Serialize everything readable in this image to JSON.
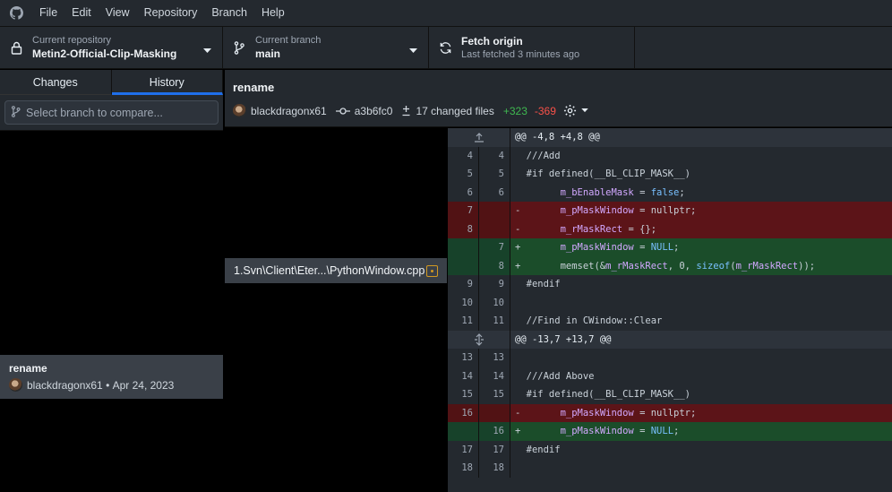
{
  "menu": [
    "File",
    "Edit",
    "View",
    "Repository",
    "Branch",
    "Help"
  ],
  "toolbar": {
    "repo_label": "Current repository",
    "repo_value": "Metin2-Official-Clip-Masking",
    "branch_label": "Current branch",
    "branch_value": "main",
    "fetch_label": "Fetch origin",
    "fetch_sub": "Last fetched 3 minutes ago"
  },
  "tabs": {
    "changes": "Changes",
    "history": "History"
  },
  "compare": {
    "placeholder": "Select branch to compare..."
  },
  "history": {
    "title": "rename",
    "author": "blackdragonx61",
    "date": "Apr 24, 2023"
  },
  "commit": {
    "title": "rename",
    "author": "blackdragonx61",
    "sha": "a3b6fc0",
    "changed": "17 changed files",
    "additions": "+323",
    "deletions": "-369"
  },
  "file": {
    "path": "1.Svn\\Client\\Eter...\\PythonWindow.cpp"
  },
  "diff": {
    "hunk1": "@@ -4,8 +4,8 @@",
    "hunk2": "@@ -13,7 +13,7 @@",
    "lines": [
      {
        "old": "4",
        "new": "4",
        "t": "ctx",
        "text": "///Add"
      },
      {
        "old": "5",
        "new": "5",
        "t": "ctx",
        "text": "#if defined(__BL_CLIP_MASK__)"
      },
      {
        "old": "6",
        "new": "6",
        "t": "ctx",
        "text": "m_bEnableMask = false;"
      },
      {
        "old": "7",
        "new": "",
        "t": "rem",
        "text": "m_pMaskWindow = nullptr;"
      },
      {
        "old": "8",
        "new": "",
        "t": "rem",
        "text": "m_rMaskRect = {};"
      },
      {
        "old": "",
        "new": "7",
        "t": "ins",
        "text": "m_pMaskWindow = NULL;"
      },
      {
        "old": "",
        "new": "8",
        "t": "ins",
        "text": "memset(&m_rMaskRect, 0, sizeof(m_rMaskRect));"
      },
      {
        "old": "9",
        "new": "9",
        "t": "ctx",
        "text": "#endif"
      },
      {
        "old": "10",
        "new": "10",
        "t": "ctx",
        "text": ""
      },
      {
        "old": "11",
        "new": "11",
        "t": "ctx",
        "text": "//Find in CWindow::Clear"
      },
      {
        "old": "13",
        "new": "13",
        "t": "ctx",
        "text": ""
      },
      {
        "old": "14",
        "new": "14",
        "t": "ctx",
        "text": "///Add Above"
      },
      {
        "old": "15",
        "new": "15",
        "t": "ctx",
        "text": "#if defined(__BL_CLIP_MASK__)"
      },
      {
        "old": "16",
        "new": "",
        "t": "rem",
        "text": "m_pMaskWindow = nullptr;"
      },
      {
        "old": "",
        "new": "16",
        "t": "ins",
        "text": "m_pMaskWindow = NULL;"
      },
      {
        "old": "17",
        "new": "17",
        "t": "ctx",
        "text": "#endif"
      },
      {
        "old": "18",
        "new": "18",
        "t": "ctx",
        "text": ""
      }
    ]
  },
  "colors": {
    "accent": "#1f6feb",
    "add": "#3fb950",
    "del": "#f85149",
    "modified": "#d29922"
  }
}
